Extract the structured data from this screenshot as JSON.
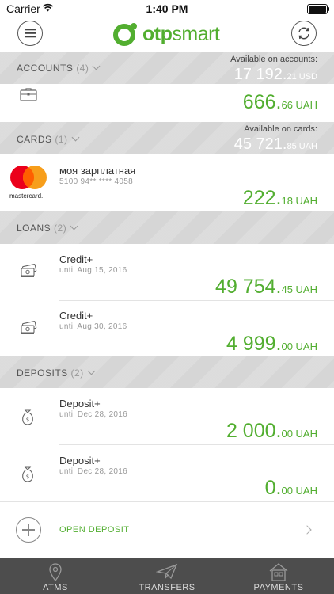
{
  "status": {
    "carrier": "Carrier",
    "time": "1:40 PM"
  },
  "app": {
    "logo_text_bold": "otp",
    "logo_text_light": "smart"
  },
  "accounts": {
    "title": "ACCOUNTS",
    "count": "(4)",
    "available_label": "Available on accounts:",
    "available_int": "17 192.",
    "available_dec": "21 USD",
    "items": [
      {
        "amount_int": "666.",
        "amount_dec": "66 UAH",
        "icon": "briefcase-icon"
      }
    ]
  },
  "cards": {
    "title": "CARDS",
    "count": "(1)",
    "available_label": "Available on cards:",
    "available_int": "45 721.",
    "available_dec": "85 UAH",
    "items": [
      {
        "name": "моя зарплатная",
        "number": "5100 94** **** 4058",
        "brand": "mastercard.",
        "amount_int": "222.",
        "amount_dec": "18 UAH"
      }
    ]
  },
  "loans": {
    "title": "LOANS",
    "count": "(2)",
    "items": [
      {
        "name": "Credit+",
        "until": "until Aug 15, 2016",
        "amount_int": "49 754.",
        "amount_dec": "45 UAH",
        "icon": "money-stack-icon"
      },
      {
        "name": "Credit+",
        "until": "until Aug 30, 2016",
        "amount_int": "4 999.",
        "amount_dec": "00 UAH",
        "icon": "money-stack-icon"
      }
    ]
  },
  "deposits": {
    "title": "DEPOSITS",
    "count": "(2)",
    "items": [
      {
        "name": "Deposit+",
        "until": "until Dec 28, 2016",
        "amount_int": "2 000.",
        "amount_dec": "00 UAH",
        "icon": "money-bag-icon"
      },
      {
        "name": "Deposit+",
        "until": "until Dec 28, 2016",
        "amount_int": "0.",
        "amount_dec": "00 UAH",
        "icon": "money-bag-icon"
      }
    ],
    "open_label": "OPEN DEPOSIT"
  },
  "tabs": [
    {
      "label": "ATMS",
      "icon": "location-pin-icon"
    },
    {
      "label": "TRANSFERS",
      "icon": "paper-plane-icon"
    },
    {
      "label": "PAYMENTS",
      "icon": "house-icon"
    }
  ],
  "colors": {
    "accent": "#52ae30",
    "tabbar": "#4d4d4d",
    "section": "#dadada"
  }
}
